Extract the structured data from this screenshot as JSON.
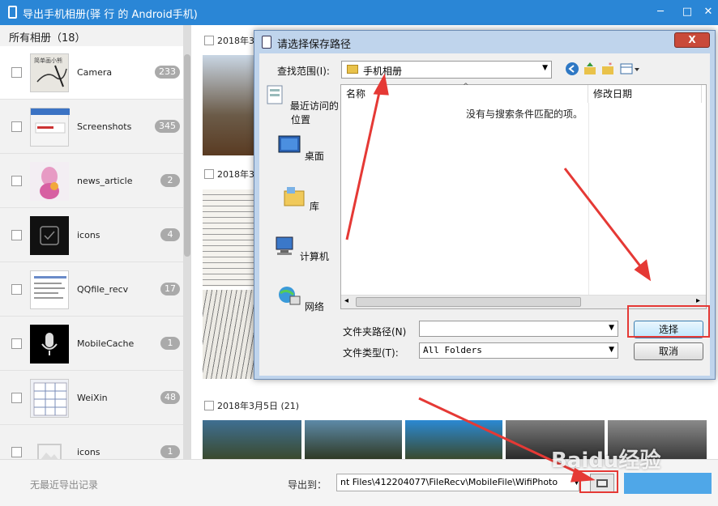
{
  "window": {
    "title": "导出手机相册(驿 行 的 Android手机)",
    "minimize_icon": "─",
    "maximize_icon": "□",
    "close_icon": "✕"
  },
  "sidebar": {
    "header": "所有相册（18）",
    "albums": [
      {
        "name": "Camera",
        "count": "233"
      },
      {
        "name": "Screenshots",
        "count": "345"
      },
      {
        "name": "news_article",
        "count": "2"
      },
      {
        "name": "icons",
        "count": "4"
      },
      {
        "name": "QQfile_recv",
        "count": "17"
      },
      {
        "name": "MobileCache",
        "count": "1"
      },
      {
        "name": "WeiXin",
        "count": "48"
      },
      {
        "name": "icons",
        "count": "1"
      }
    ]
  },
  "main": {
    "groups": [
      {
        "label": "2018年3月"
      },
      {
        "label": "2018年3月"
      },
      {
        "label": "2018年3月5日 (21)"
      }
    ]
  },
  "bottom": {
    "no_record": "无最近导出记录",
    "export_label": "导出到：",
    "export_path": "nt Files\\412204077\\FileRecv\\MobileFile\\WifiPhoto"
  },
  "dialog": {
    "title": "请选择保存路径",
    "close_icon": "X",
    "lookin_label": "查找范围(I):",
    "lookin_value": "手机相册",
    "places": [
      "最近访问的位置",
      "桌面",
      "库",
      "计算机",
      "网络"
    ],
    "columns": {
      "name": "名称",
      "modified": "修改日期"
    },
    "empty_message": "没有与搜索条件匹配的项。",
    "folder_path_label": "文件夹路径(N)",
    "folder_path_value": "",
    "file_type_label": "文件类型(T):",
    "file_type_value": "All Folders",
    "select_button": "选择",
    "cancel_button": "取消"
  },
  "watermark": "Baidu经验"
}
